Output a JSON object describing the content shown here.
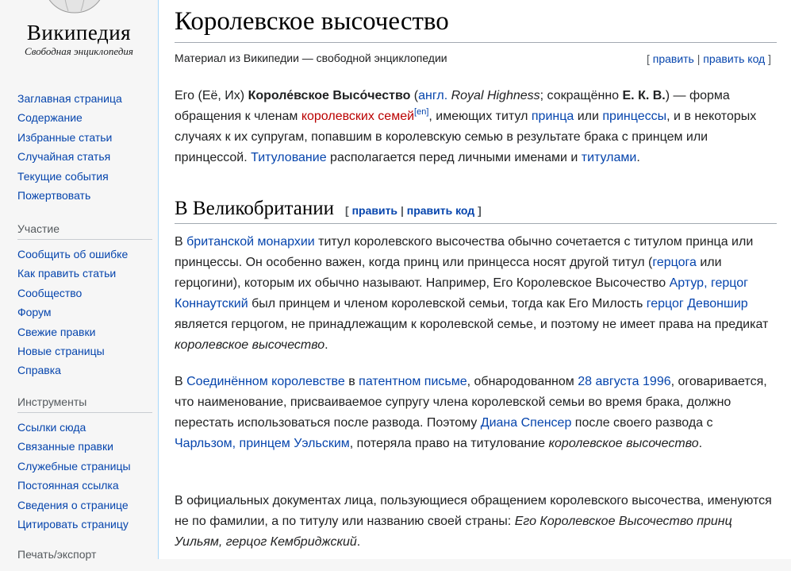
{
  "logo": {
    "wordmark": "Википедия",
    "tagline": "Свободная энциклопедия"
  },
  "sidebar": {
    "navigation": [
      "Заглавная страница",
      "Содержание",
      "Избранные статьи",
      "Случайная статья",
      "Текущие события",
      "Пожертвовать"
    ],
    "participation": {
      "heading": "Участие",
      "items": [
        "Сообщить об ошибке",
        "Как править статьи",
        "Сообщество",
        "Форум",
        "Свежие правки",
        "Новые страницы",
        "Справка"
      ]
    },
    "tools": {
      "heading": "Инструменты",
      "items": [
        "Ссылки сюда",
        "Связанные правки",
        "Служебные страницы",
        "Постоянная ссылка",
        "Сведения о странице",
        "Цитировать страницу"
      ]
    },
    "print": {
      "heading": "Печать/экспорт"
    }
  },
  "article": {
    "title": "Королевское высочество",
    "site_sub": "Материал из Википедии — свободной энциклопедии",
    "edit_links": {
      "open": "[",
      "edit": "править",
      "sep": "|",
      "edit_code": "править код",
      "close": "]"
    },
    "intro": {
      "t1": "Его (Её, Их) ",
      "b1": "Короле́вское Высо́чество",
      "t2": " (",
      "l_angl": "англ.",
      "t3": " ",
      "i1": "Royal Highness",
      "t4": "; сокращённо ",
      "b2": "Е. К. В.",
      "t5": ") — форма обращения к членам ",
      "red1": "королевских семей",
      "sup1": "[en]",
      "t6": ", имеющих титул ",
      "l1": "принца",
      "t7": " или ",
      "l2": "принцессы",
      "t8": ", и в некоторых случаях к их супругам, попавшим в королевскую семью в результате брака с принцем или принцессой. ",
      "l3": "Титулование",
      "t9": " располагается перед личными именами и ",
      "l4": "титулами",
      "t10": "."
    },
    "section1": {
      "heading": "В Великобритании",
      "p1": {
        "t1": "В ",
        "l1": "британской монархии",
        "t2": " титул королевского высочества обычно сочетается с титулом принца или принцессы. Он особенно важен, когда принц или принцесса носят другой титул (",
        "l2": "герцога",
        "t3": " или герцогини), которым их обычно называют. Например, Его Королевское Высочество ",
        "l3": "Артур, герцог Коннаутский",
        "t4": " был принцем и членом королевской семьи, тогда как Его Милость ",
        "l4": "герцог Девоншир",
        "t5": " является герцогом, не принадлежащим к королевской семье, и поэтому не имеет права на предикат ",
        "i1": "королевское высочество",
        "t6": "."
      },
      "p2": {
        "t1": "В ",
        "l1": "Соединённом королевстве",
        "t2": " в ",
        "l2": "патентном письме",
        "t3": ", обнародованном ",
        "l3": "28 августа",
        "t4": " ",
        "l4": "1996",
        "t5": ", оговаривается, что наименование, присваиваемое супругу члена королевской семьи во время брака, должно перестать использоваться после развода. Поэтому ",
        "l5": "Диана Спенсер",
        "t6": " после своего развода с ",
        "l6": "Чарльзом, принцем Уэльским",
        "t7": ", потеряла право на титулование ",
        "i1": "королевское высочество",
        "t8": "."
      },
      "p3": {
        "t1": "В официальных документах лица, пользующиеся обращением королевского высочества, именуются не по фамилии, а по титулу или названию своей страны: ",
        "i1": "Его Королевское Высочество принц Уильям, герцог Кембриджский",
        "t2": "."
      }
    }
  },
  "colors": {
    "link": "#0645ad",
    "redlink": "#ba0000",
    "sidebar_bg": "#f6f6f6",
    "border_blue": "#a7d7f9"
  },
  "icons": [
    "wikipedia-globe-logo"
  ]
}
